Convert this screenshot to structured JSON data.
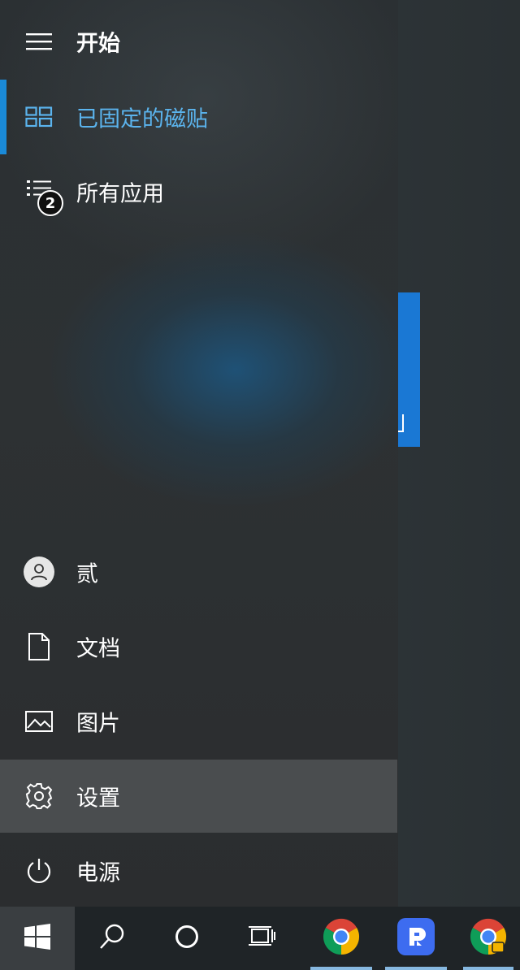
{
  "header": {
    "title": "开始"
  },
  "nav": {
    "pinned_label": "已固定的磁贴",
    "all_apps_label": "所有应用",
    "all_apps_badge": "2"
  },
  "bottom": {
    "user_label": "贰",
    "documents_label": "文档",
    "pictures_label": "图片",
    "settings_label": "设置",
    "power_label": "电源"
  },
  "colors": {
    "accent": "#1a8ad8",
    "pinned_text": "#5bb4ee",
    "selected_bg": "#4a4d4f",
    "taskbar_bg": "#1f2427"
  },
  "taskbar": {
    "icons": [
      "windows-icon",
      "search-icon",
      "cortana-icon",
      "task-view-icon",
      "chrome-icon",
      "app-icon",
      "chrome-icon"
    ]
  }
}
